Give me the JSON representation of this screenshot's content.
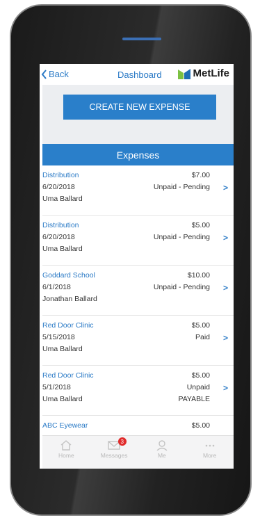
{
  "nav": {
    "back_label": "Back",
    "title": "Dashboard",
    "brand": "MetLife"
  },
  "create_button_label": "CREATE NEW EXPENSE",
  "section_header": "Expenses",
  "expenses": [
    {
      "provider": "Distribution",
      "date": "6/20/2018",
      "person": "Uma Ballard",
      "amount": "$7.00",
      "status": "Unpaid - Pending",
      "sub": ""
    },
    {
      "provider": "Distribution",
      "date": "6/20/2018",
      "person": "Uma Ballard",
      "amount": "$5.00",
      "status": "Unpaid - Pending",
      "sub": ""
    },
    {
      "provider": "Goddard School",
      "date": "6/1/2018",
      "person": "Jonathan Ballard",
      "amount": "$10.00",
      "status": "Unpaid - Pending",
      "sub": ""
    },
    {
      "provider": "Red Door Clinic",
      "date": "5/15/2018",
      "person": "Uma Ballard",
      "amount": "$5.00",
      "status": "Paid",
      "sub": ""
    },
    {
      "provider": "Red Door Clinic",
      "date": "5/1/2018",
      "person": "Uma Ballard",
      "amount": "$5.00",
      "status": "Unpaid",
      "sub": "PAYABLE"
    },
    {
      "provider": "ABC Eyewear",
      "date": "",
      "person": "",
      "amount": "$5.00",
      "status": "",
      "sub": ""
    }
  ],
  "tabs": [
    {
      "label": "Home",
      "icon": "home-icon"
    },
    {
      "label": "Messages",
      "icon": "envelope-icon",
      "badge": "3"
    },
    {
      "label": "Me",
      "icon": "person-icon"
    },
    {
      "label": "More",
      "icon": "more-dots-icon"
    }
  ],
  "colors": {
    "accent": "#2a7fca",
    "link": "#2a7ac6",
    "badge": "#e02b2b",
    "logo_green": "#7cc142",
    "logo_blue": "#1f6fb5"
  }
}
